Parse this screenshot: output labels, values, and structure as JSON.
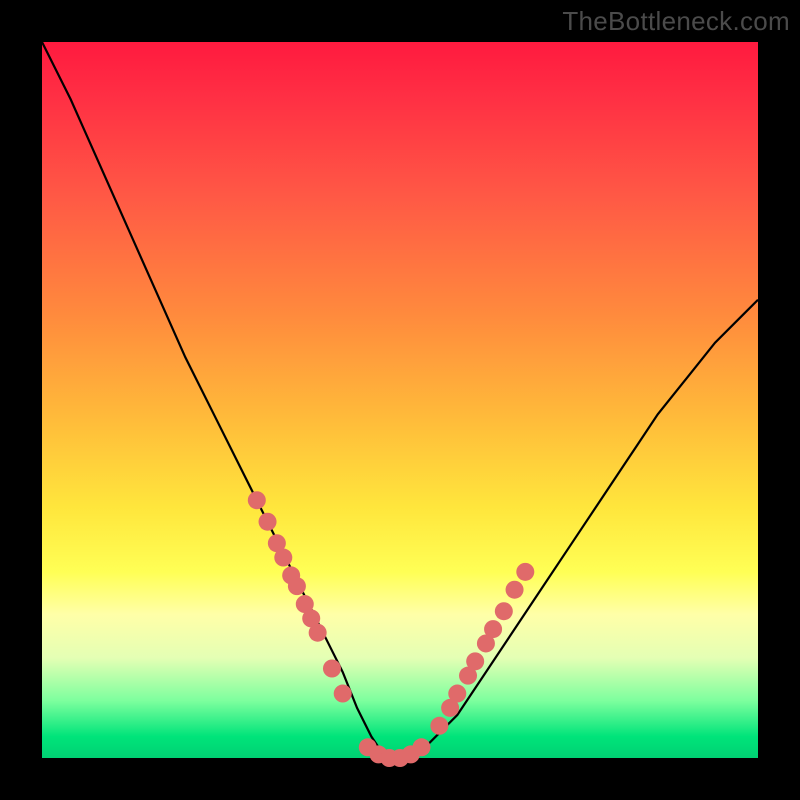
{
  "watermark": "TheBottleneck.com",
  "chart_data": {
    "type": "line",
    "title": "",
    "xlabel": "",
    "ylabel": "",
    "xlim": [
      0,
      100
    ],
    "ylim": [
      0,
      100
    ],
    "curve": {
      "description": "V-shaped bottleneck curve",
      "x": [
        0,
        4,
        8,
        12,
        16,
        20,
        24,
        28,
        32,
        36,
        38,
        40,
        42,
        44,
        46,
        48,
        50,
        52,
        54,
        58,
        62,
        66,
        70,
        74,
        78,
        82,
        86,
        90,
        94,
        98,
        100
      ],
      "y": [
        100,
        92,
        83,
        74,
        65,
        56,
        48,
        40,
        32,
        24,
        20,
        16,
        12,
        7,
        3,
        0,
        0,
        0,
        2,
        6,
        12,
        18,
        24,
        30,
        36,
        42,
        48,
        53,
        58,
        62,
        64
      ]
    },
    "series": [
      {
        "name": "left-cluster",
        "type": "scatter",
        "color": "#e06a6a",
        "x": [
          30.0,
          31.5,
          32.8,
          33.7,
          34.8,
          35.6,
          36.7,
          37.6,
          38.5,
          40.5,
          42.0
        ],
        "y": [
          36.0,
          33.0,
          30.0,
          28.0,
          25.5,
          24.0,
          21.5,
          19.5,
          17.5,
          12.5,
          9.0
        ]
      },
      {
        "name": "bottom-cluster",
        "type": "scatter",
        "color": "#e06a6a",
        "x": [
          45.5,
          47.0,
          48.5,
          50.0,
          51.5,
          53.0
        ],
        "y": [
          1.5,
          0.5,
          0.0,
          0.0,
          0.5,
          1.5
        ]
      },
      {
        "name": "right-cluster",
        "type": "scatter",
        "color": "#e06a6a",
        "x": [
          55.5,
          57.0,
          58.0,
          59.5,
          60.5,
          62.0,
          63.0,
          64.5,
          66.0,
          67.5
        ],
        "y": [
          4.5,
          7.0,
          9.0,
          11.5,
          13.5,
          16.0,
          18.0,
          20.5,
          23.5,
          26.0
        ]
      }
    ]
  }
}
